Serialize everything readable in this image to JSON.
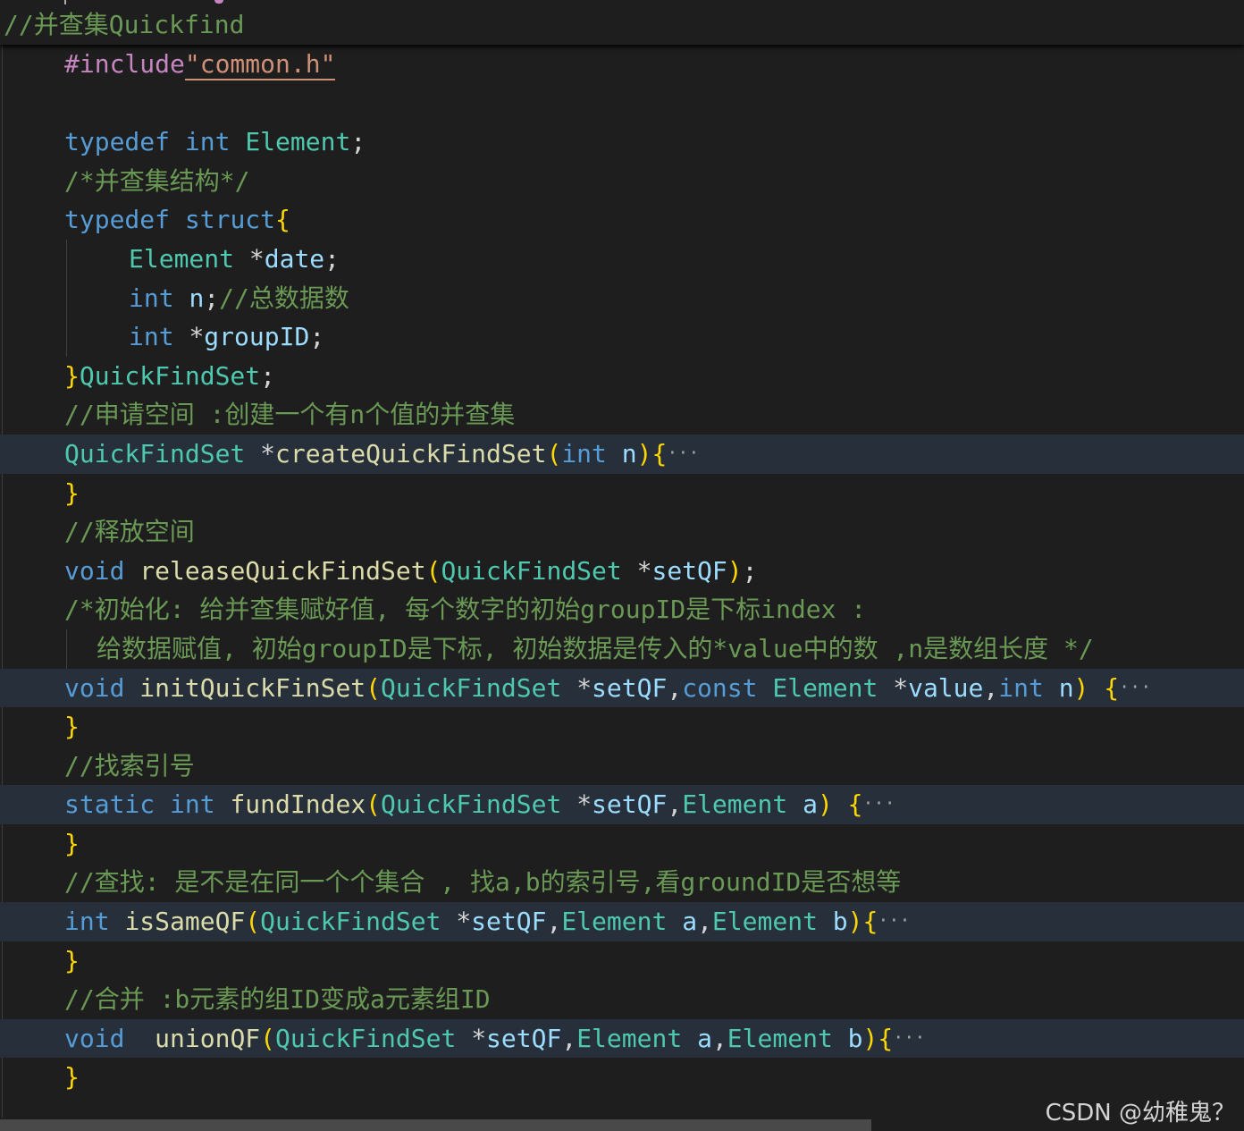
{
  "sticky_scroll": {
    "text": "//并查集Quickfind"
  },
  "lines": {
    "l01": {
      "pp": "#include",
      "str": "\"common.h\""
    },
    "l03": {
      "kw": "typedef",
      "kw2": "int",
      "ty": "Element",
      "pn": ";"
    },
    "l04": {
      "cm": "/*并查集结构*/"
    },
    "l05": {
      "kw": "typedef",
      "kw2": "struct",
      "br": "{"
    },
    "l06": {
      "ty": "Element",
      "pn": "*",
      "var": "date",
      "pn2": ";"
    },
    "l07": {
      "kw": "int",
      "var": "n",
      "pn": ";",
      "cm": "//总数据数"
    },
    "l08": {
      "kw": "int",
      "pn": "*",
      "var": "groupID",
      "pn2": ";"
    },
    "l09": {
      "br": "}",
      "ty": "QuickFindSet",
      "pn": ";"
    },
    "l10": {
      "cm": "//申请空间 :创建一个有n个值的并查集"
    },
    "l11": {
      "ty": "QuickFindSet",
      "pn": "*",
      "fn": "createQuickFindSet",
      "br": "(",
      "kw": "int",
      "var": "n",
      "br2": ")",
      "br3": "{",
      "fold": "···"
    },
    "l12": {
      "br": "}"
    },
    "l13": {
      "cm": "//释放空间"
    },
    "l14": {
      "kw": "void",
      "fn": "releaseQuickFindSet",
      "br": "(",
      "ty": "QuickFindSet",
      "pn": "*",
      "var": "setQF",
      "br2": ")",
      "pn2": ";"
    },
    "l15": {
      "cm": "/*初始化: 给并查集赋好值, 每个数字的初始groupID是下标index :"
    },
    "l16": {
      "cm": "给数据赋值, 初始groupID是下标, 初始数据是传入的*value中的数 ,n是数组长度 */"
    },
    "l17": {
      "kw": "void",
      "fn": "initQuickFinSet",
      "br": "(",
      "ty": "QuickFindSet",
      "pn": "*",
      "var": "setQF",
      "pn2": ",",
      "kw2": "const",
      "ty2": "Element",
      "pn3": "*",
      "var2": "value",
      "pn4": ",",
      "kw3": "int",
      "var3": "n",
      "br2": ")",
      "br3": "{",
      "fold": "···"
    },
    "l18": {
      "br": "}"
    },
    "l19": {
      "cm": "//找索引号"
    },
    "l20": {
      "kw": "static",
      "kw2": "int",
      "fn": "fundIndex",
      "br": "(",
      "ty": "QuickFindSet",
      "pn": "*",
      "var": "setQF",
      "pn2": ",",
      "ty2": "Element",
      "var2": "a",
      "br2": ")",
      "br3": "{",
      "fold": "···"
    },
    "l21": {
      "br": "}"
    },
    "l22": {
      "cm": "//查找: 是不是在同一个个集合 , 找a,b的索引号,看groundID是否想等"
    },
    "l23": {
      "kw": "int",
      "fn": "isSameQF",
      "br": "(",
      "ty": "QuickFindSet",
      "pn": "*",
      "var": "setQF",
      "pn2": ",",
      "ty2": "Element",
      "var2": "a",
      "pn3": ",",
      "ty3": "Element",
      "var3": "b",
      "br2": ")",
      "br3": "{",
      "fold": "···"
    },
    "l24": {
      "br": "}"
    },
    "l25": {
      "cm": "//合并 :b元素的组ID变成a元素组ID"
    },
    "l26": {
      "kw": "void",
      "fn": "unionQF",
      "br": "(",
      "ty": "QuickFindSet",
      "pn": "*",
      "var": "setQF",
      "pn2": ",",
      "ty2": "Element",
      "var2": "a",
      "pn3": ",",
      "ty3": "Element",
      "var3": "b",
      "br2": ")",
      "br3": "{",
      "fold": "···"
    },
    "l27": {
      "br": "}"
    }
  },
  "watermark": {
    "text": "CSDN @幼稚鬼？"
  },
  "colors": {
    "background": "#1e1e1e",
    "keyword": "#569cd6",
    "type": "#4ec9b0",
    "function": "#dcdcaa",
    "variable": "#9cdcfe",
    "string": "#ce9178",
    "preprocessor": "#c586c0",
    "comment": "#6a9955",
    "bracket": "#ffd700",
    "folded_line_highlight": "#262f3a"
  }
}
